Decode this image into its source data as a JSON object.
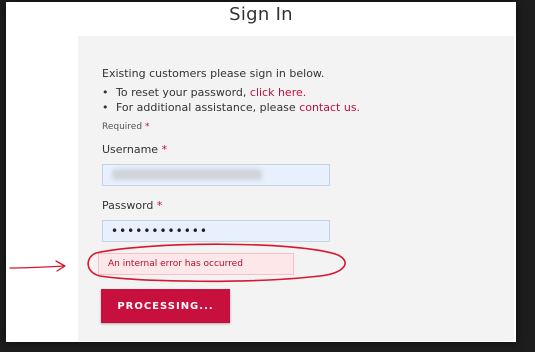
{
  "page": {
    "title": "Sign In"
  },
  "signin": {
    "intro": "Existing customers please sign in below.",
    "bullets": [
      {
        "text": "To reset your password, ",
        "link": "click here."
      },
      {
        "text": "For additional assistance, please ",
        "link": "contact us."
      }
    ],
    "required_label": "Required",
    "asterisk": "*",
    "username": {
      "label": "Username",
      "value": ""
    },
    "password": {
      "label": "Password",
      "value": "••••••••••••"
    },
    "error": "An internal error has occurred",
    "submit_label": "PROCESSING..."
  },
  "colors": {
    "accent": "#c8103f",
    "link": "#c0103a",
    "annotation": "#d9162f"
  }
}
